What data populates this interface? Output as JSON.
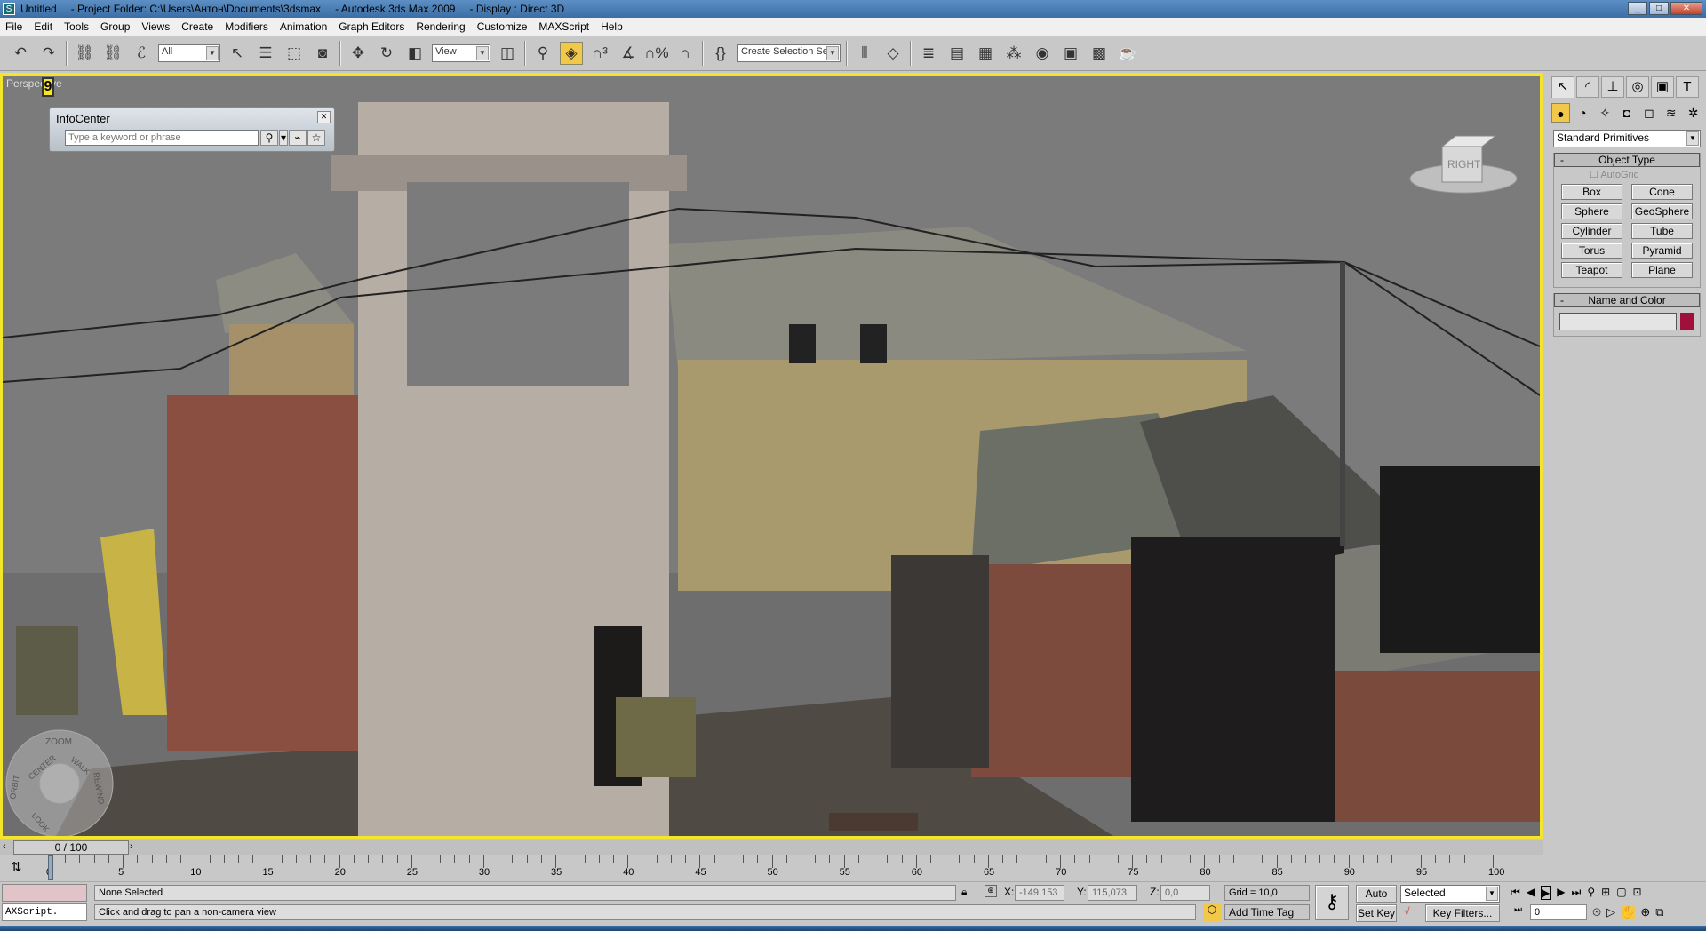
{
  "titlebar": {
    "title": "Untitled",
    "project": "- Project Folder: C:\\Users\\Антон\\Documents\\3dsmax",
    "app": "- Autodesk 3ds Max  2009",
    "display": "- Display : Direct 3D"
  },
  "menu": [
    "File",
    "Edit",
    "Tools",
    "Group",
    "Views",
    "Create",
    "Modifiers",
    "Animation",
    "Graph Editors",
    "Rendering",
    "Customize",
    "MAXScript",
    "Help"
  ],
  "toolbar": {
    "selection_filter": "All",
    "ref_coord": "View",
    "named_selection_placeholder": "Create Selection Set"
  },
  "viewport": {
    "label": "Perspective",
    "viewport_number": "9",
    "viewcube_label": "RIGHT",
    "navwheel": {
      "zoom": "ZOOM",
      "orbit": "ORBIT",
      "center": "CENTER",
      "walk": "WALK",
      "rewind": "REWIND",
      "look": "LOOK"
    }
  },
  "infocenter": {
    "title": "InfoCenter",
    "placeholder": "Type a keyword or phrase"
  },
  "command_panel": {
    "category": "Standard Primitives",
    "object_type_title": "Object Type",
    "autogrid": "AutoGrid",
    "primitives": [
      "Box",
      "Cone",
      "Sphere",
      "GeoSphere",
      "Cylinder",
      "Tube",
      "Torus",
      "Pyramid",
      "Teapot",
      "Plane"
    ],
    "name_color_title": "Name and Color",
    "object_name": "",
    "object_color": "#a0103a"
  },
  "timeline": {
    "frame_display": "0 / 100",
    "current_frame": 0,
    "start": 0,
    "end": 100,
    "labels": [
      "0",
      "5",
      "10",
      "15",
      "20",
      "25",
      "30",
      "35",
      "40",
      "45",
      "50",
      "55",
      "60",
      "65",
      "70",
      "75",
      "80",
      "85",
      "90",
      "95",
      "100"
    ]
  },
  "status": {
    "selection": "None Selected",
    "prompt": "Click and drag to pan a non-camera view",
    "maxscript": "AXScript.",
    "x_label": "X:",
    "x": "-149,153",
    "y_label": "Y:",
    "y": "115,073",
    "z_label": "Z:",
    "z": "0,0",
    "grid": "Grid = 10,0",
    "add_time_tag": "Add Time Tag",
    "auto_key": "Auto Key",
    "set_key": "Set Key",
    "key_mode": "Selected",
    "key_filters": "Key Filters...",
    "frame": "0"
  },
  "colors": {
    "viewport_border": "#f5e52a",
    "active_button": "#f2c84b"
  }
}
